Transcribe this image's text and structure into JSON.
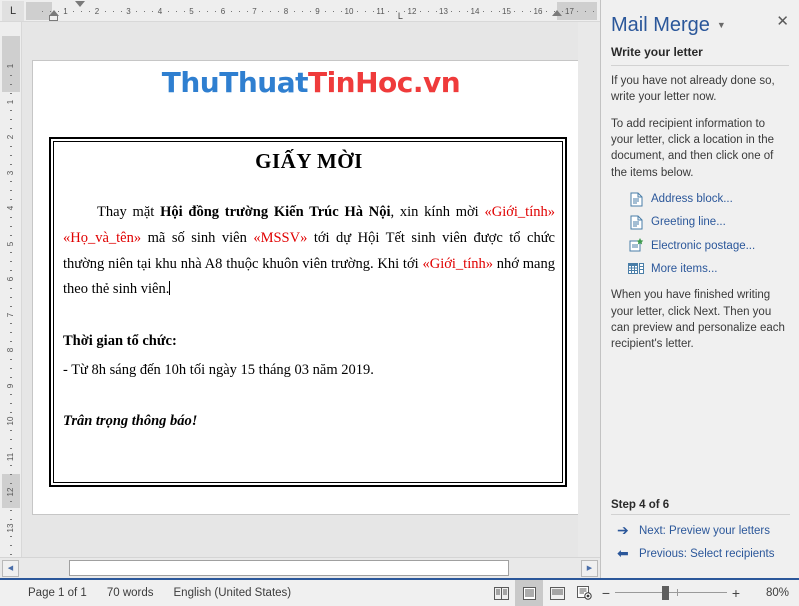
{
  "rulers": {
    "horizontal_marks": [
      1,
      2,
      3,
      4,
      5,
      6,
      7,
      8,
      9,
      10,
      11,
      12,
      13,
      14,
      15,
      16,
      17
    ],
    "vertical_marks": [
      1,
      1,
      2,
      3,
      4,
      5,
      6,
      7,
      8,
      9,
      10,
      11,
      12,
      13
    ],
    "tab_selector_glyph": "L",
    "tab_stop_glyph": "L"
  },
  "watermark": {
    "part_blue": "ThuThuat",
    "part_red": "TinHoc.vn",
    "blue": "#2f7fd0",
    "red": "#ef3b3b"
  },
  "document": {
    "title": "GIẤY MỜI",
    "paragraph": {
      "seg1": "Thay mặt ",
      "seg2_bold": "Hội đồng trường Kiến Trúc Hà Nội",
      "seg3": ", xin kính mời ",
      "field1": "«Giới_tính»",
      "field2": "«Họ_và_tên»",
      "seg4": " mã số sinh viên ",
      "field3": "«MSSV»",
      "seg5": " tới dự Hội Tết sinh viên được tổ chức thường niên tại khu nhà A8 thuộc khuôn viên trường. Khi tới ",
      "field4": "«Giới_tính»",
      "seg6": " nhớ mang theo thẻ sinh viên."
    },
    "time_heading": "Thời gian tổ chức:",
    "time_line": "- Từ 8h sáng đến 10h tối ngày 15 tháng 03 năm 2019.",
    "closing": "Trân trọng thông báo!"
  },
  "panel": {
    "title": "Mail Merge",
    "caret_icon": "chevron-down-icon",
    "close_icon": "close-icon",
    "section_heading": "Write your letter",
    "intro_text": "If you have not already done so, write your letter now.",
    "instruction_text": "To add recipient information to your letter, click a location in the document, and then click one of the items below.",
    "links": [
      {
        "label": "Address block...",
        "icon": "document-page-icon"
      },
      {
        "label": "Greeting line...",
        "icon": "document-page-icon"
      },
      {
        "label": "Electronic postage...",
        "icon": "document-star-icon"
      },
      {
        "label": "More items...",
        "icon": "table-grid-icon"
      }
    ],
    "finish_text": "When you have finished writing your letter, click Next. Then you can preview and personalize each recipient's letter.",
    "step_label": "Step 4 of 6",
    "next_label": "Next: Preview your letters",
    "previous_label": "Previous: Select recipients",
    "next_arrow": "arrow-right-icon",
    "previous_arrow": "arrow-left-icon",
    "accent": "#2b579a"
  },
  "status_bar": {
    "page_info": "Page 1 of 1",
    "word_count": "70 words",
    "language": "English (United States)",
    "zoom_level": "80%",
    "zoom_out_label": "−",
    "zoom_in_label": "+",
    "view_buttons": [
      {
        "name": "read-mode-view",
        "active": false
      },
      {
        "name": "print-layout-view",
        "active": true
      },
      {
        "name": "web-layout-view",
        "active": false
      }
    ],
    "macro_icon": "record-macro-icon"
  },
  "scrollbars": {
    "left_arrow": "◀",
    "right_arrow": "▶"
  }
}
